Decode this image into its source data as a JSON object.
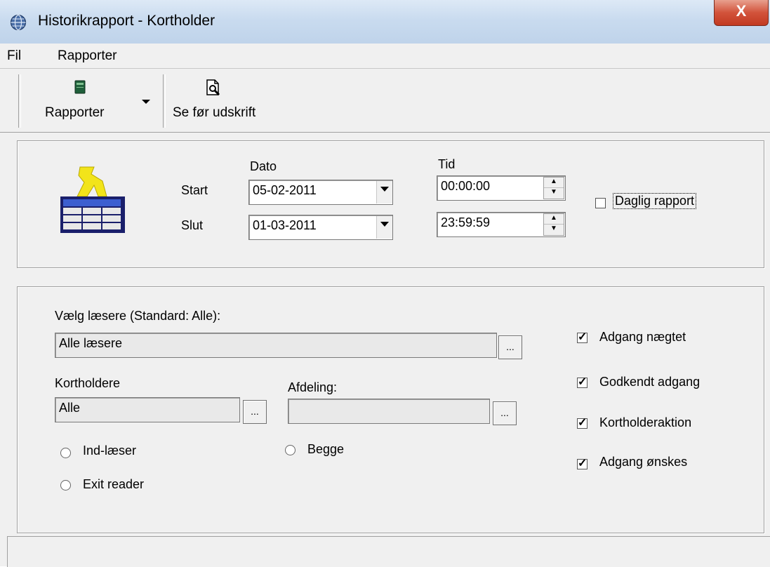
{
  "window": {
    "title": "Historikrapport - Kortholder",
    "close_glyph": "X"
  },
  "menu": {
    "items": [
      "Fil",
      "Rapporter"
    ]
  },
  "toolbar": {
    "rapporter_label": "Rapporter",
    "rapporter_icon": "book-icon",
    "dropdown_icon": "chevron-down-icon",
    "preview_label": "Se før udskrift",
    "preview_icon": "print-preview-icon"
  },
  "period": {
    "dato_header": "Dato",
    "tid_header": "Tid",
    "start_label": "Start",
    "slut_label": "Slut",
    "start_date": "05-02-2011",
    "end_date": "01-03-2011",
    "start_time": "00:00:00",
    "end_time": "23:59:59",
    "daily_report_label": "Daglig rapport",
    "daily_report_checked": false,
    "report_icon": "report-table-icon"
  },
  "filters": {
    "readers_label": "Vælg læsere (Standard: Alle):",
    "readers_value": "Alle læsere",
    "cardholders_label": "Kortholdere",
    "cardholders_value": "Alle",
    "department_label": "Afdeling:",
    "department_value": "",
    "browse_label": "...",
    "radios": [
      "Ind-læser",
      "Exit reader",
      "Begge"
    ],
    "checkboxes": [
      {
        "label": "Adgang nægtet",
        "checked": true
      },
      {
        "label": "Godkendt adgang",
        "checked": true
      },
      {
        "label": "Kortholderaktion",
        "checked": true
      },
      {
        "label": "Adgang ønskes",
        "checked": true
      }
    ]
  },
  "colors": {
    "face": "#f0f0f0",
    "close": "#c23a21",
    "titlebar": "#c9dbef"
  }
}
